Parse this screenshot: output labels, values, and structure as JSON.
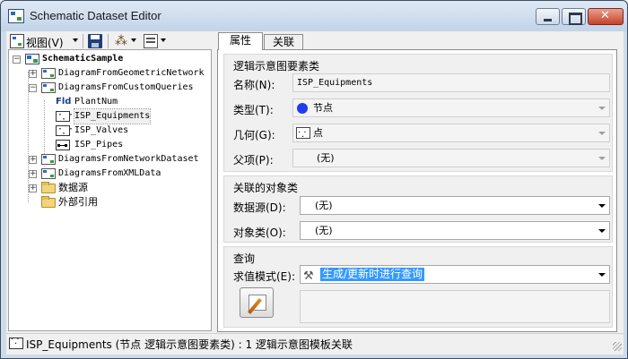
{
  "window": {
    "title": "Schematic Dataset Editor"
  },
  "toolbar": {
    "view_label": "视图(V)"
  },
  "tree": {
    "root": "SchematicSample",
    "items": [
      {
        "label": "DiagramFromGeometricNetwork"
      },
      {
        "label": "DiagramsFromCustomQueries"
      },
      {
        "label": "PlantNum"
      },
      {
        "label": "ISP_Equipments"
      },
      {
        "label": "ISP_Valves"
      },
      {
        "label": "ISP_Pipes"
      },
      {
        "label": "DiagramsFromNetworkDataset"
      },
      {
        "label": "DiagramsFromXMLData"
      },
      {
        "label": "数据源"
      },
      {
        "label": "外部引用"
      }
    ],
    "fld_badge": "Fld"
  },
  "tabs": [
    {
      "label": "属性"
    },
    {
      "label": "关联"
    }
  ],
  "properties": {
    "group_title": "逻辑示意图要素类",
    "name_label": "名称(N):",
    "name_value": "ISP_Equipments",
    "type_label": "类型(T):",
    "type_value": "节点",
    "geometry_label": "几何(G):",
    "geometry_value": "点",
    "parent_label": "父项(P):",
    "parent_value": "(无)"
  },
  "associated": {
    "group_title": "关联的对象类",
    "datasource_label": "数据源(D):",
    "datasource_value": "(无)",
    "objectclass_label": "对象类(O):",
    "objectclass_value": "(无)"
  },
  "query": {
    "group_title": "查询",
    "eval_label": "求值模式(E):",
    "eval_value": "生成/更新时进行查询"
  },
  "status": {
    "text": "ISP_Equipments (节点 逻辑示意图要素类) : 1 逻辑示意图模板关联"
  },
  "colors": {
    "selection": "#3399ff",
    "node_dot": "#1e3cf0"
  }
}
